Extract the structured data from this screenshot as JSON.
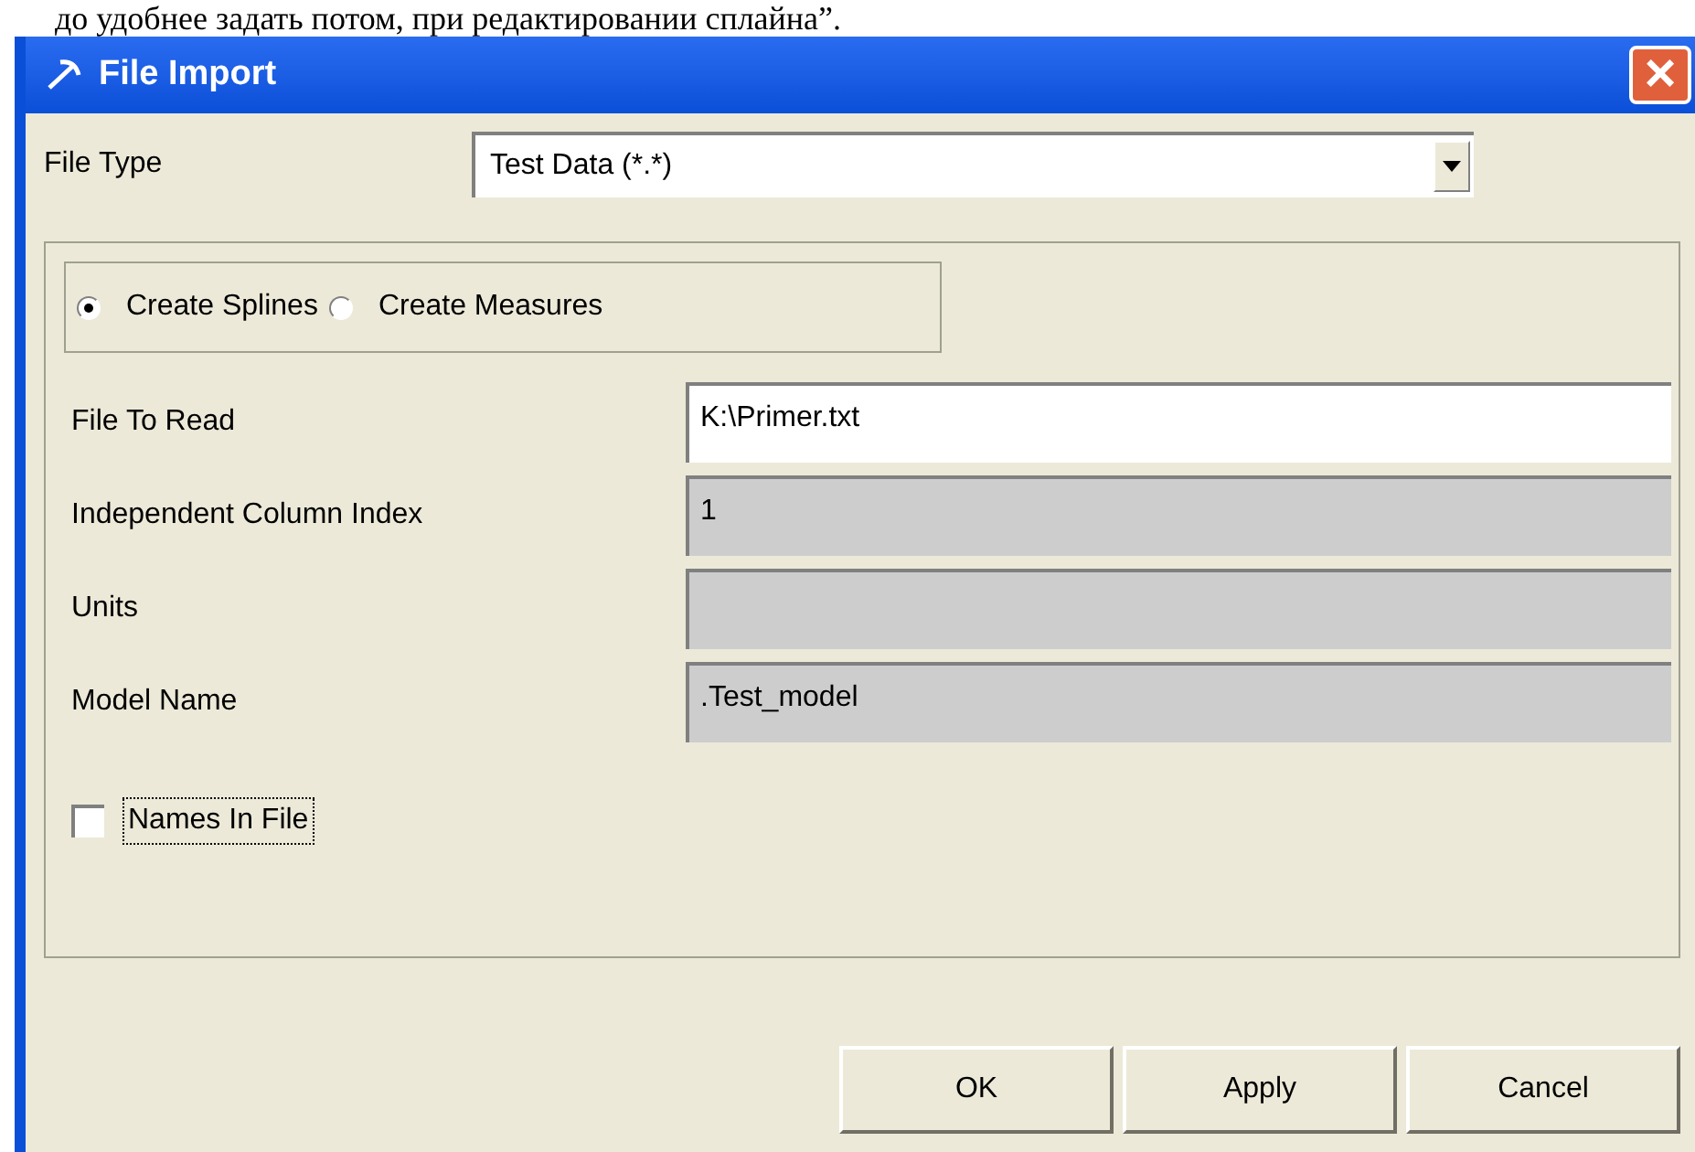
{
  "document_text": "до удобнее задать потом, при редактировании сплайна”.",
  "window": {
    "title": "File Import",
    "close": "×"
  },
  "file_type": {
    "label": "File Type",
    "value": "Test Data (*.*)"
  },
  "mode": [
    {
      "label": "Create Splines",
      "selected": true
    },
    {
      "label": "Create Measures",
      "selected": false
    }
  ],
  "fields": [
    {
      "label": "File To Read",
      "value": "K:\\Primer.txt",
      "disabled": false
    },
    {
      "label": "Independent Column Index",
      "value": "1",
      "disabled": true
    },
    {
      "label": "Units",
      "disabled": true
    },
    {
      "label": "Model Name",
      "value": ".Test_model",
      "disabled": true
    }
  ],
  "names_in_file": {
    "label": "Names In File",
    "checked": false,
    "focused": true
  },
  "buttons": [
    "OK",
    "Apply",
    "Cancel"
  ]
}
